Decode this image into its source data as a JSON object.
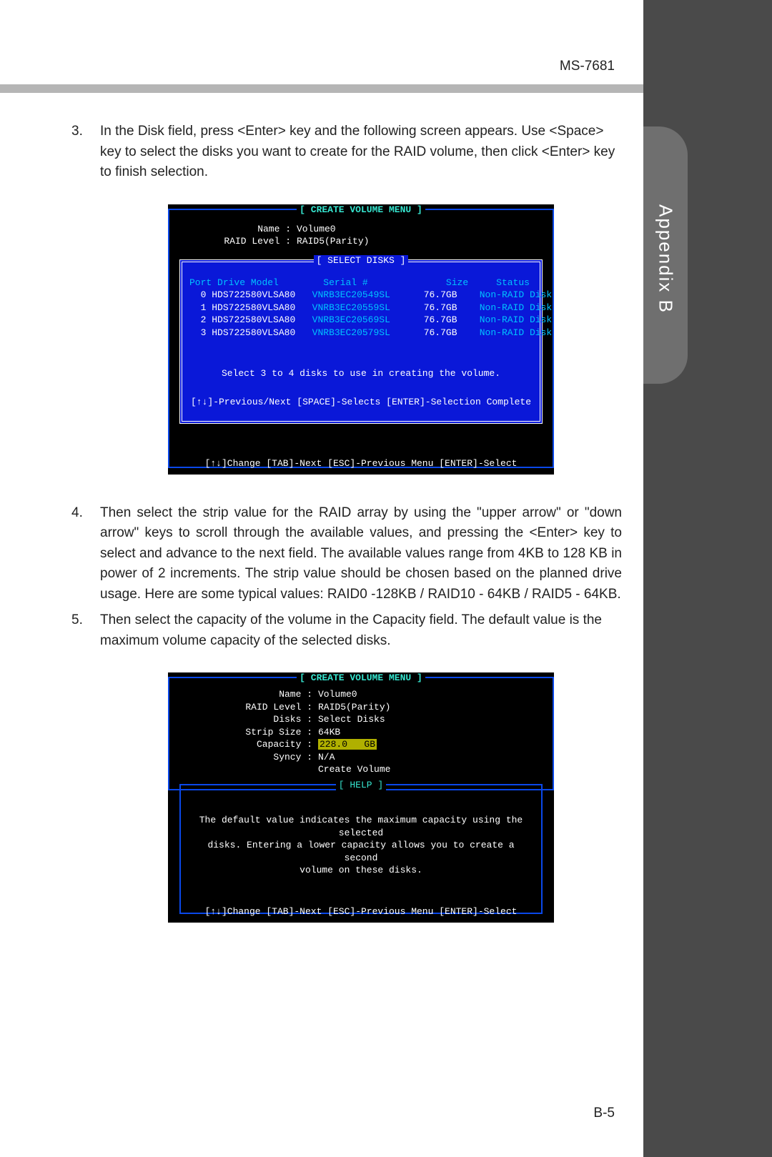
{
  "header": {
    "doc_id": "MS-7681"
  },
  "side_tab": "Appendix B",
  "page_number": "B-5",
  "steps": {
    "s3": {
      "num": "3.",
      "text": "In the Disk field, press <Enter> key and the following screen appears. Use <Space> key to select the disks you want to create for the RAID volume, then click <Enter> key to finish selection."
    },
    "s4": {
      "num": "4.",
      "text": "Then select the strip value for the RAID array by using the \"upper arrow\" or \"down arrow\" keys to scroll through the available values, and pressing the <Enter> key to select and advance to the next field. The available values range from 4KB to 128 KB in power of 2 increments. The strip value should be chosen based on the planned drive usage. Here are some typical values: RAID0 -128KB / RAID10 - 64KB / RAID5 - 64KB."
    },
    "s5": {
      "num": "5.",
      "text": "Then select the capacity of the volume in the Capacity field. The default value is the maximum volume capacity of the selected disks."
    }
  },
  "bios1": {
    "title": "[  CREATE VOLUME MENU  ]",
    "name_label": "Name :",
    "name_value": "Volume0",
    "raid_label": "RAID Level :",
    "raid_value": "RAID5(Parity)",
    "select_title": "[  SELECT DISKS  ]",
    "head": {
      "port": "Port",
      "drive": "Drive Model",
      "serial": "Serial #",
      "size": "Size",
      "status": "Status"
    },
    "rows": [
      {
        "p": "0",
        "m": "HDS722580VLSA80",
        "s": "VNRB3EC20549SL",
        "sz": "76.7GB",
        "st": "Non-RAID Disk"
      },
      {
        "p": "1",
        "m": "HDS722580VLSA80",
        "s": "VNRB3EC20559SL",
        "sz": "76.7GB",
        "st": "Non-RAID Disk"
      },
      {
        "p": "2",
        "m": "HDS722580VLSA80",
        "s": "VNRB3EC20569SL",
        "sz": "76.7GB",
        "st": "Non-RAID Disk"
      },
      {
        "p": "3",
        "m": "HDS722580VLSA80",
        "s": "VNRB3EC20579SL",
        "sz": "76.7GB",
        "st": "Non-RAID Disk"
      }
    ],
    "instr": "Select 3 to 4 disks to use in creating the volume.",
    "keys": {
      "a": "[↑↓]-Previous/Next",
      "b": "[SPACE]-Selects",
      "c": "[ENTER]-Selection Complete"
    },
    "bottom": "[↑↓]Change   [TAB]-Next   [ESC]-Previous Menu   [ENTER]-Select"
  },
  "bios2": {
    "title": "[  CREATE VOLUME MENU  ]",
    "rows": {
      "name_l": "Name :",
      "name_v": "Volume0",
      "raid_l": "RAID Level :",
      "raid_v": "RAID5(Parity)",
      "disks_l": "Disks :",
      "disks_v": "Select Disks",
      "strip_l": "Strip Size :",
      "strip_v": "64KB",
      "cap_l": "Capacity :",
      "cap_v": "228.0   GB",
      "sync_l": "Syncy :",
      "sync_v": "N/A",
      "create": "Create Volume"
    },
    "help_title": "[  HELP  ]",
    "help_text1": "The default value indicates the maximum  capacity using the selected",
    "help_text2": "disks.  Entering a lower capacity allows you to create a second",
    "help_text3": "volume on these disks.",
    "bottom": "[↑↓]Change   [TAB]-Next   [ESC]-Previous Menu   [ENTER]-Select"
  }
}
